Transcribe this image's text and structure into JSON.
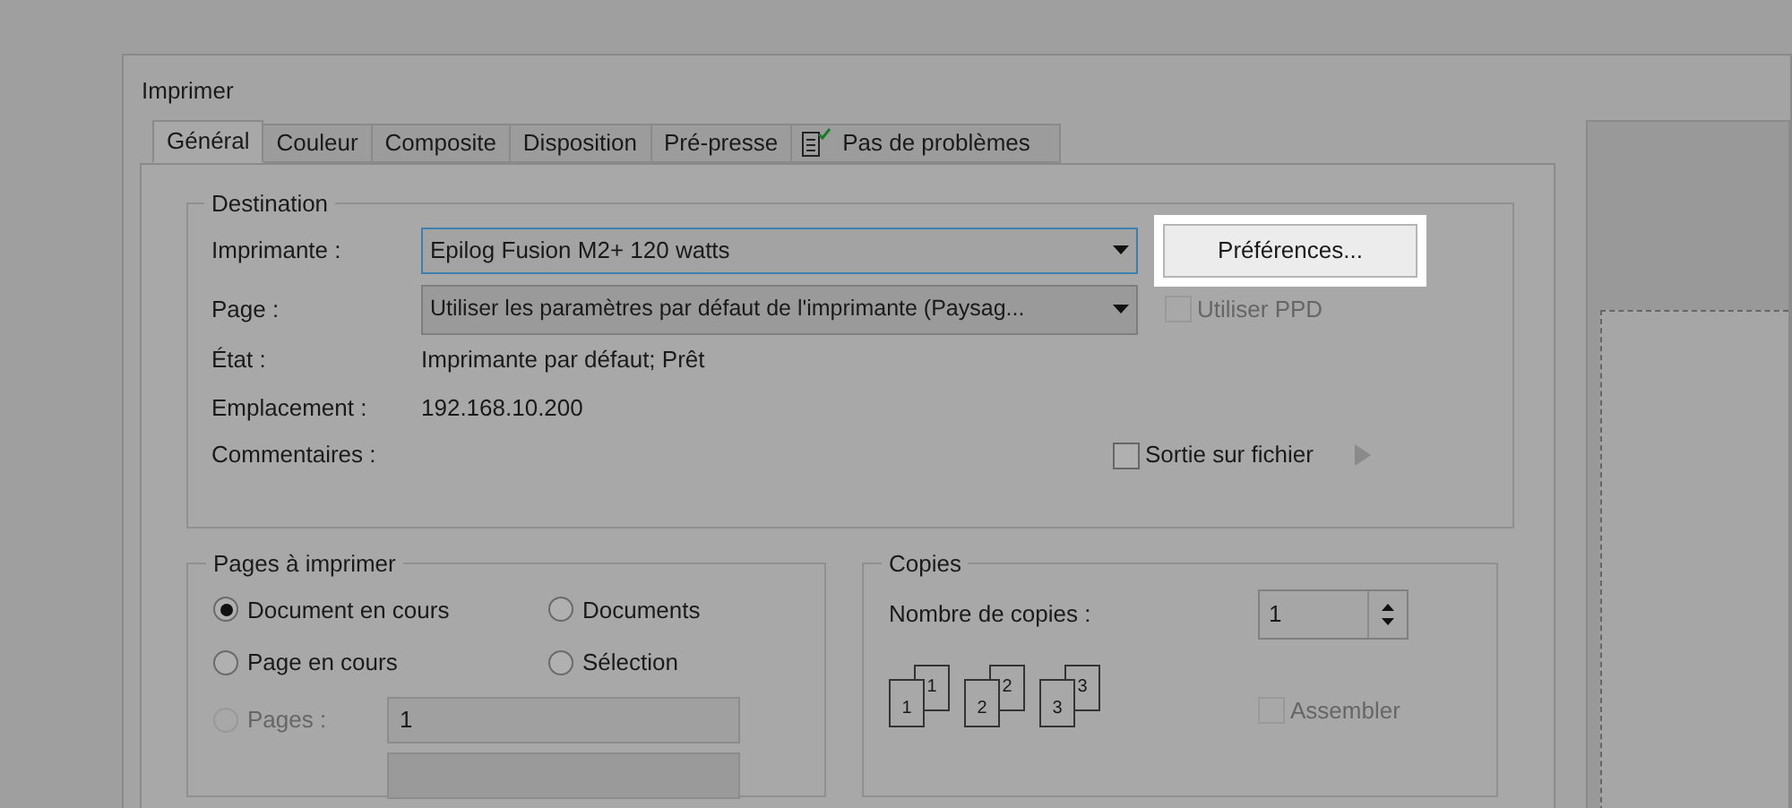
{
  "window": {
    "title": "Imprimer"
  },
  "tabs": [
    {
      "label": "Général",
      "selected": true,
      "kind": "text"
    },
    {
      "label": "Couleur",
      "selected": false,
      "kind": "text"
    },
    {
      "label": "Composite",
      "selected": false,
      "kind": "text"
    },
    {
      "label": "Disposition",
      "selected": false,
      "kind": "text"
    },
    {
      "label": "Pré-presse",
      "selected": false,
      "kind": "text"
    },
    {
      "label": "Pas de problèmes",
      "selected": false,
      "kind": "icon"
    }
  ],
  "destination": {
    "title": "Destination",
    "printer": {
      "label": "Imprimante :",
      "value": "Epilog Fusion M2+ 120 watts",
      "focused": true
    },
    "preferences_button": {
      "label": "Préférences...",
      "highlighted": true
    },
    "page": {
      "label": "Page :",
      "value": "Utiliser les paramètres par défaut de l'imprimante (Paysag..."
    },
    "use_ppd": {
      "label": "Utiliser PPD",
      "checked": false,
      "disabled": true
    },
    "state": {
      "label": "État :",
      "value": "Imprimante par défaut; Prêt"
    },
    "location": {
      "label": "Emplacement :",
      "value": "192.168.10.200"
    },
    "comments": {
      "label": "Commentaires :"
    },
    "output_to_file": {
      "label": "Sortie sur fichier",
      "checked": false
    }
  },
  "pages_to_print": {
    "title": "Pages à imprimer",
    "options": [
      {
        "label": "Document en cours",
        "selected": true,
        "disabled": false
      },
      {
        "label": "Documents",
        "selected": false,
        "disabled": false
      },
      {
        "label": "Page en cours",
        "selected": false,
        "disabled": false
      },
      {
        "label": "Sélection",
        "selected": false,
        "disabled": false
      },
      {
        "label": "Pages :",
        "selected": false,
        "disabled": true
      }
    ],
    "pages_field": {
      "value": "1"
    }
  },
  "copies": {
    "title": "Copies",
    "count": {
      "label": "Nombre de copies :",
      "value": "1"
    },
    "sheets": [
      {
        "front": "1",
        "back": "1"
      },
      {
        "front": "2",
        "back": "2"
      },
      {
        "front": "3",
        "back": "3"
      }
    ],
    "collate": {
      "label": "Assembler",
      "checked": false,
      "disabled": true
    }
  }
}
